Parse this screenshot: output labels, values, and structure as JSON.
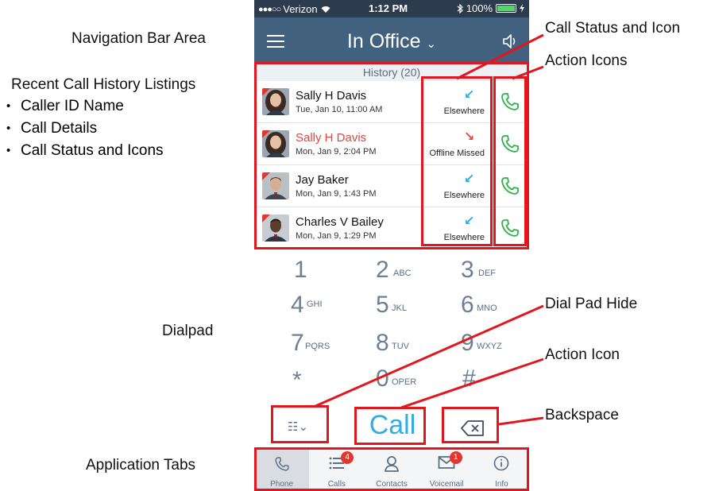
{
  "annotations": {
    "nav_bar_area": "Navigation Bar Area",
    "recent_history_title": "Recent Call History Listings",
    "recent_history_bullets": [
      "Caller ID Name",
      "Call Details",
      "Call Status and Icons"
    ],
    "dialpad": "Dialpad",
    "application_tabs": "Application Tabs",
    "call_status_and_icon": "Call Status and Icon",
    "action_icons": "Action Icons",
    "dial_pad_hide": "Dial Pad Hide",
    "action_icon": "Action Icon",
    "backspace": "Backspace"
  },
  "status_bar": {
    "signal": "●●●○○",
    "carrier": "Verizon",
    "time": "1:12 PM",
    "battery_percent": "100%"
  },
  "nav": {
    "title": "In Office",
    "chevron": "⌄"
  },
  "history": {
    "header": "History (20)"
  },
  "calls": [
    {
      "name": "Sally H Davis",
      "date": "Tue, Jan 10, 11:00 AM",
      "status": "Elsewhere",
      "status_icon": "↙",
      "missed": false
    },
    {
      "name": "Sally H Davis",
      "date": "Mon, Jan 9, 2:04 PM",
      "status": "Offline Missed",
      "status_icon": "↘",
      "missed": true
    },
    {
      "name": "Jay Baker",
      "date": "Mon, Jan 9, 1:43 PM",
      "status": "Elsewhere",
      "status_icon": "↙",
      "missed": false
    },
    {
      "name": "Charles V Bailey",
      "date": "Mon, Jan 9, 1:29 PM",
      "status": "Elsewhere",
      "status_icon": "↙",
      "missed": false
    }
  ],
  "dialpad_keys": [
    {
      "num": "1",
      "letters": ""
    },
    {
      "num": "2",
      "letters": "ABC"
    },
    {
      "num": "3",
      "letters": "DEF"
    },
    {
      "num": "4",
      "letters": "GHI"
    },
    {
      "num": "5",
      "letters": "JKL"
    },
    {
      "num": "6",
      "letters": "MNO"
    },
    {
      "num": "7",
      "letters": "PQRS"
    },
    {
      "num": "8",
      "letters": "TUV"
    },
    {
      "num": "9",
      "letters": "WXYZ"
    },
    {
      "num": "*",
      "letters": ""
    },
    {
      "num": "0",
      "letters": "OPER"
    },
    {
      "num": "#",
      "letters": ""
    }
  ],
  "dialpad_bottom": {
    "hide_glyph": "☷⌄",
    "call_label": "Call"
  },
  "tabs": [
    {
      "label": "Phone",
      "icon": "phone-icon",
      "badge": "",
      "active": true
    },
    {
      "label": "Calls",
      "icon": "list-icon",
      "badge": "4",
      "active": false
    },
    {
      "label": "Contacts",
      "icon": "contacts-icon",
      "badge": "",
      "active": false
    },
    {
      "label": "Voicemail",
      "icon": "mail-icon",
      "badge": "1",
      "active": false
    },
    {
      "label": "Info",
      "icon": "info-icon",
      "badge": "",
      "active": false
    }
  ],
  "colors": {
    "nav_bg": "#41617f",
    "status_bar_bg": "#2c3b4e",
    "missed_red": "#e1473d",
    "incoming_blue": "#2eaee6",
    "action_green": "#2db34a",
    "highlight_red": "#e2161f"
  }
}
